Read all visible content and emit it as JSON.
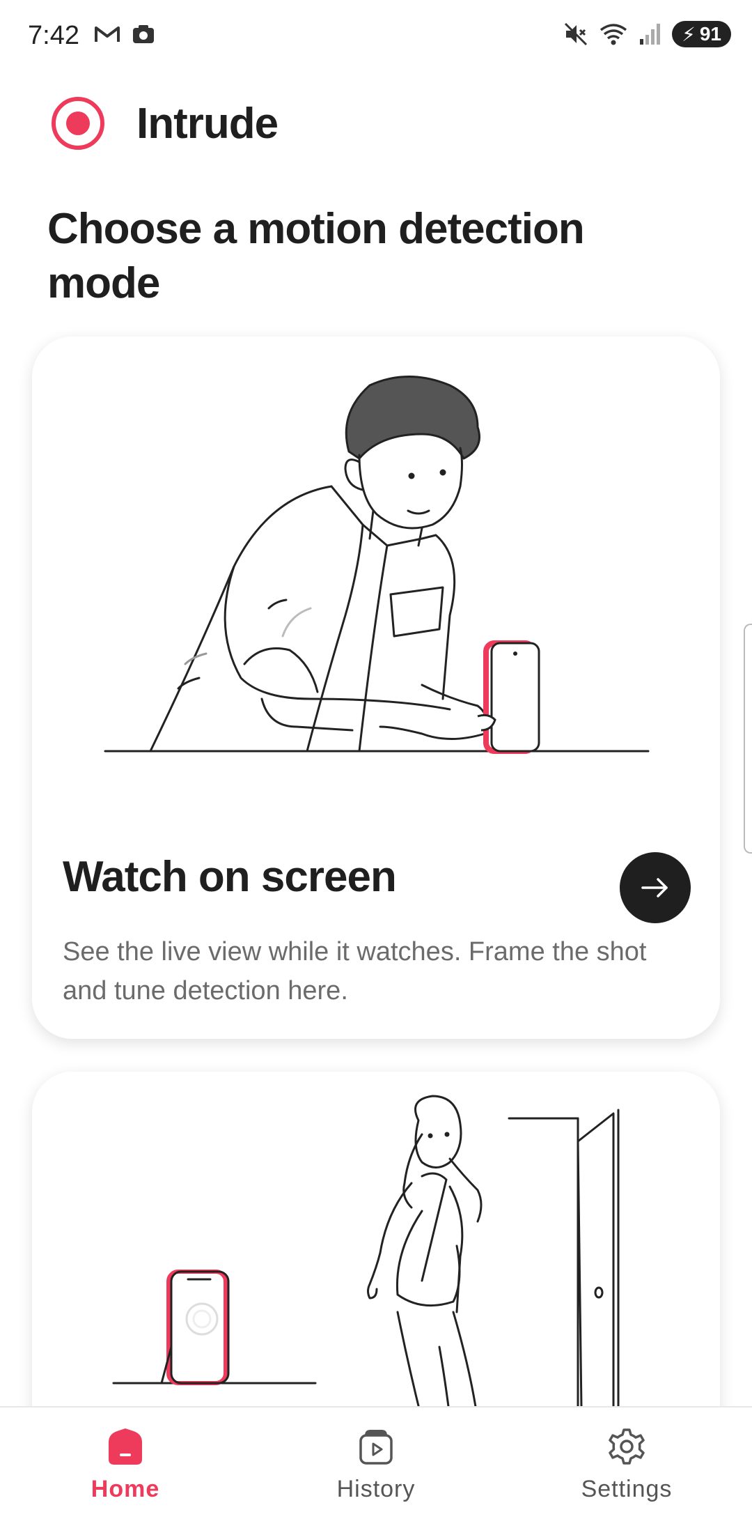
{
  "status_bar": {
    "time": "7:42",
    "battery": "91",
    "icons": [
      "gmail-icon",
      "camera-icon",
      "mute-icon",
      "wifi-icon",
      "signal-icon",
      "battery-icon"
    ]
  },
  "app": {
    "name": "Intrude",
    "accent_color": "#ee3b5b"
  },
  "page": {
    "title": "Choose a motion detection mode"
  },
  "cards": [
    {
      "title": "Watch on screen",
      "description": "See the live view while it watches. Frame the shot and tune detection here.",
      "action_icon": "arrow-right-icon"
    },
    {
      "illustration": "woman-walking-door-illustration"
    }
  ],
  "bottom_nav": {
    "items": [
      {
        "label": "Home",
        "icon": "home-icon",
        "active": true
      },
      {
        "label": "History",
        "icon": "history-icon",
        "active": false
      },
      {
        "label": "Settings",
        "icon": "settings-icon",
        "active": false
      }
    ]
  }
}
